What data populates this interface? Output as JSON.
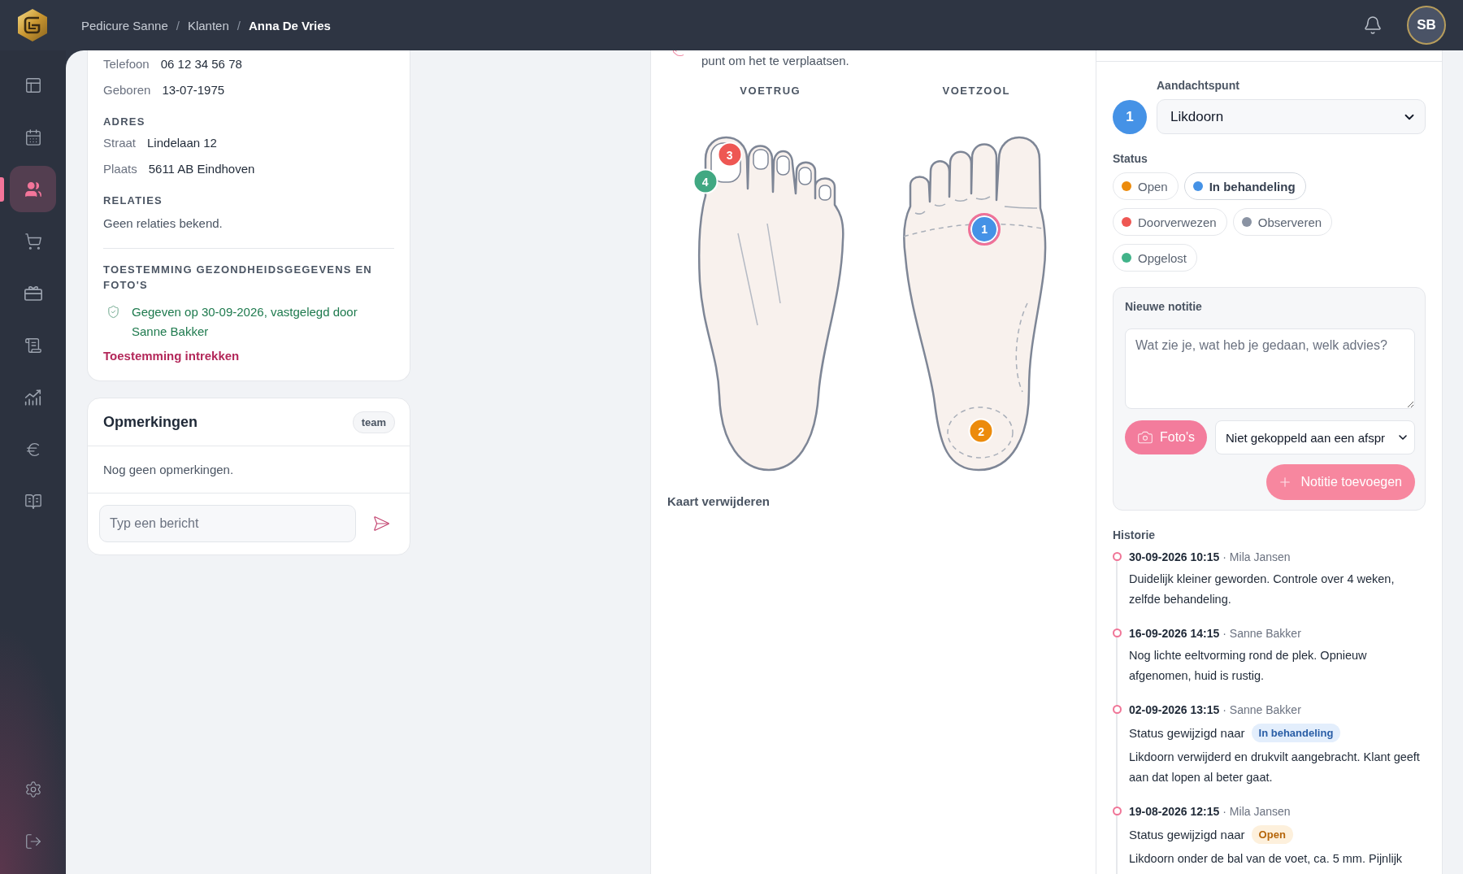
{
  "header": {
    "breadcrumbs": [
      {
        "label": "Pedicure Sanne",
        "current": false,
        "separator": "/"
      },
      {
        "label": "Klanten",
        "current": false,
        "separator": "/"
      },
      {
        "label": "Anna De Vries",
        "current": true
      }
    ],
    "avatar": "SB"
  },
  "sidebar": {
    "items": [
      {
        "selected": false
      },
      {
        "selected": false
      },
      {
        "selected": true
      },
      {
        "selected": false
      },
      {
        "selected": false
      },
      {
        "selected": false
      },
      {
        "selected": false
      },
      {
        "selected": false
      },
      {
        "selected": false
      }
    ]
  },
  "client_card": {
    "contact": [
      {
        "label": "Telefoon",
        "value": "06 12 34 56 78"
      },
      {
        "label": "Geboren",
        "value": "13-07-1975"
      }
    ],
    "address": {
      "heading": "ADRES",
      "rows": [
        {
          "label": "Straat",
          "value": "Lindelaan 12"
        },
        {
          "label": "Plaats",
          "value": "5611 AB Eindhoven"
        }
      ]
    },
    "relations": {
      "heading": "RELATIES",
      "text": "Geen relaties bekend."
    },
    "consent": {
      "heading": "TOESTEMMING GEZONDHEIDSGEGEVENS EN FOTO'S",
      "text": "Gegeven op 30-09-2026, vastgelegd door Sanne Bakker",
      "action": "Toestemming intrekken"
    }
  },
  "remarks": {
    "title": "Opmerkingen",
    "badge": "team",
    "empty_text": "Nog geen opmerkingen.",
    "input": {
      "placeholder": "Typ een bericht"
    }
  },
  "foot_map": {
    "hint": "punt om het te verplaatsen.",
    "views": [
      {
        "label": "VOETRUG",
        "kind": "back",
        "markers": [
          {
            "number": "3",
            "color": "#ee5753",
            "selected": false
          },
          {
            "number": "4",
            "color": "#41a882",
            "selected": false
          }
        ]
      },
      {
        "label": "VOETZOOL",
        "kind": "sole",
        "markers": [
          {
            "number": "1",
            "color": "#4592e6",
            "selected": true
          },
          {
            "number": "2",
            "color": "#ec8b0c",
            "selected": false
          }
        ]
      }
    ],
    "delete_action": "Kaart verwijderen"
  },
  "point_panel": {
    "point": {
      "label": "Aandachtspunt",
      "number": "1",
      "color": "#4592e6",
      "value": "Likdoorn"
    },
    "status": {
      "label": "Status",
      "options": [
        {
          "label": "Open",
          "color": "#ec8b0c",
          "selected": false
        },
        {
          "label": "In behandeling",
          "color": "#4592e6",
          "selected": true
        },
        {
          "label": "Doorverwezen",
          "color": "#ee5753",
          "selected": false
        },
        {
          "label": "Observeren",
          "color": "#8a93a3",
          "selected": false
        },
        {
          "label": "Opgelost",
          "color": "#41b389",
          "selected": false
        }
      ]
    },
    "new_note": {
      "title": "Nieuwe notitie",
      "placeholder": "Wat zie je, wat heb je gedaan, welk advies?",
      "photo_button": "Foto's",
      "appointment": "Niet gekoppeld aan een afspr",
      "submit": "Notitie toevoegen"
    },
    "history": {
      "title": "Historie",
      "entries": [
        {
          "time": "30-09-2026 10:15",
          "author": "· Mila Jansen",
          "note": "Duidelijk kleiner geworden. Controle over 4 weken, zelfde behandeling."
        },
        {
          "time": "16-09-2026 14:15",
          "author": "· Sanne Bakker",
          "note": "Nog lichte eeltvorming rond de plek. Opnieuw afgenomen, huid is rustig."
        },
        {
          "time": "02-09-2026 13:15",
          "author": "· Sanne Bakker",
          "status_change": {
            "text": "Status gewijzigd naar",
            "status": "In behandeling",
            "kind": "in_progress"
          },
          "note": "Likdoorn verwijderd en drukvilt aangebracht. Klant geeft aan dat lopen al beter gaat."
        },
        {
          "time": "19-08-2026 12:15",
          "author": "· Mila Jansen",
          "status_change": {
            "text": "Status gewijzigd naar",
            "status": "Open",
            "kind": "open"
          },
          "note": "Likdoorn onder de bal van de voet, ca. 5 mm. Pijnlijk"
        }
      ]
    }
  }
}
